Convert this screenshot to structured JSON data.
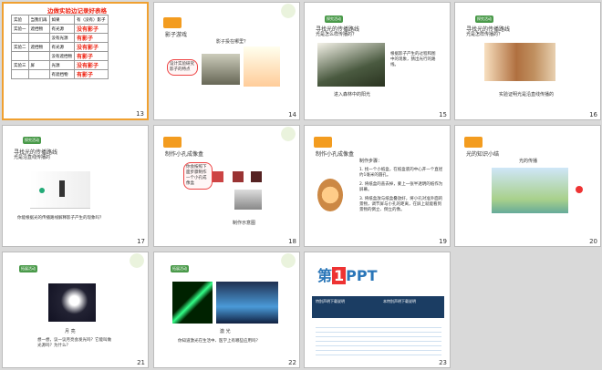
{
  "slides": [
    {
      "num": "13",
      "title": "边做实验边记录好表格",
      "table": [
        [
          "实验",
          "当我们再",
          "如果",
          "有（没有）影子"
        ],
        [
          "实验一",
          "遮挡物",
          "有光源",
          "没有影子"
        ],
        [
          "",
          "",
          "没有光源",
          "有影子"
        ],
        [
          "实验二",
          "遮挡物",
          "有光源",
          "没有影子"
        ],
        [
          "",
          "",
          "没有遮挡物",
          "有影子"
        ],
        [
          "实验三",
          "屏",
          "光源",
          "没有影子"
        ],
        [
          "",
          "",
          "有遮挡物",
          "有影子"
        ]
      ]
    },
    {
      "num": "14",
      "title": "影子游戏",
      "caption": "影子投在哪里？",
      "note": "设计实验研究影子的特点"
    },
    {
      "num": "15",
      "tag": "探究活动",
      "title": "寻找光的传播路线",
      "sub": "光是怎么样传播的？",
      "side": "根据影子产生的过程和图中的现象，猜出光行的路线。",
      "caption": "进入森林中的阳光"
    },
    {
      "num": "16",
      "tag": "探究活动",
      "title": "寻找光的传播路线",
      "sub": "光是怎样传播的？",
      "caption": "实验证明光是沿直线传播的"
    },
    {
      "num": "17",
      "tag": "探究活动",
      "title": "寻找光的传播路线",
      "sub": "光是沿直线传播的",
      "caption": "你能根据光的传播路线解释影子产生的现象吗？"
    },
    {
      "num": "18",
      "title": "制作小孔成像盒",
      "note": "你会按照下面步骤制作一个小孔成像盒",
      "caption": "制作示意图"
    },
    {
      "num": "19",
      "title": "制作小孔成像盒",
      "steps": "制作步骤：",
      "s1": "1. 找一个小纸盒，在纸盒底的中心开一个直径约1毫米的圆孔。",
      "s2": "2. 将纸盒的盖去掉，蒙上一张半透明的纸作为屏幕。",
      "s3": "3. 将纸盒放与纸盒叠放好，将小孔对准外面的景物，调节屏与小孔的距离，在屏上就能看到景物的倒立、倒立的像。"
    },
    {
      "num": "20",
      "tag": "小结",
      "title": "光的知识小结",
      "sub": "光的传播"
    },
    {
      "num": "21",
      "tag": "拓展活动",
      "caption": "月 亮",
      "q": "想一想，议一议月亮会发光吗？它能叫做光源吗？为什么？"
    },
    {
      "num": "22",
      "tag": "拓展活动",
      "caption": "激 光",
      "q": "你知道激光在生活中、医学上有哪些应用吗？"
    },
    {
      "num": "23",
      "logo1": "第",
      "logo2": "1",
      "logo3": "PPT",
      "head1": "特别声明下载说明",
      "head2": "本特别声明下载说明"
    }
  ]
}
